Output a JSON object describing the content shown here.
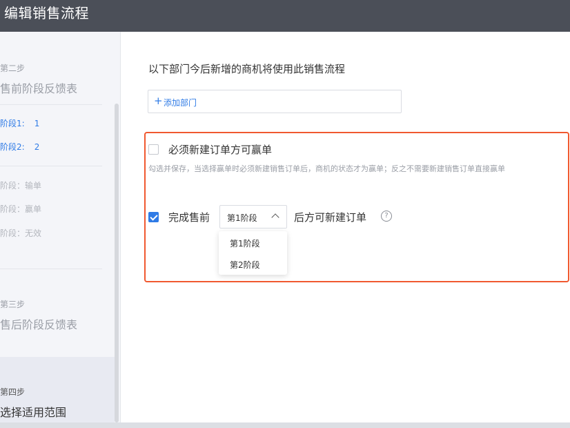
{
  "window": {
    "title": "编辑销售流程"
  },
  "sidebar": {
    "step2": {
      "step": "第二步",
      "title": "售前阶段反馈表"
    },
    "stages": [
      {
        "name": "阶段1:",
        "value": "1"
      },
      {
        "name": "阶段2:",
        "value": "2"
      }
    ],
    "fixed_stages": [
      "阶段：输单",
      "阶段：赢单",
      "阶段：无效"
    ],
    "step3": {
      "step": "第三步",
      "title": "售后阶段反馈表"
    },
    "step4": {
      "step": "第四步",
      "title": "选择适用范围"
    }
  },
  "main": {
    "heading": "以下部门今后新增的商机将使用此销售流程",
    "add_department": {
      "icon": "plus-icon",
      "plus": "+",
      "label": "添加部门"
    },
    "option1": {
      "checked": false,
      "label": "必须新建订单方可赢单",
      "hint": "勾选并保存，当选择赢单时必须新建销售订单后，商机的状态才为赢单；反之不需要新建销售订单直接赢单"
    },
    "option2": {
      "checked": true,
      "prefix": "完成售前",
      "selected": "第1阶段",
      "suffix": "后方可新建订单",
      "help": "?"
    },
    "dropdown_options": [
      "第1阶段",
      "第2阶段"
    ]
  },
  "colors": {
    "accent": "#2f7be6",
    "highlight": "#f0582f",
    "titlebar": "#4b4f58"
  }
}
